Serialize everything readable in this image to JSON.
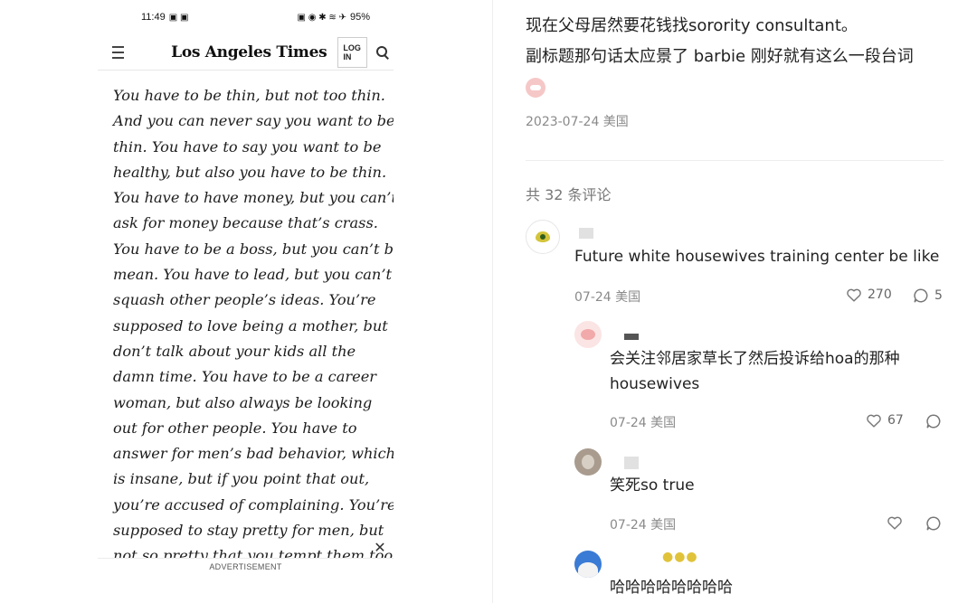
{
  "phone": {
    "status": {
      "time": "11:49",
      "battery": "95%",
      "left_glyphs": "▣ ▣",
      "right_glyphs": "▣ ◉ ✱ ≋ ✈"
    },
    "header": {
      "logo": "Los Angeles Times",
      "login": "LOG IN"
    },
    "article_lines": [
      "You have to be thin, but not too thin.",
      "And you can never say you want to be",
      "thin. You have to say you want to be",
      "healthy, but also you have to be thin.",
      "You have to have money, but you can’t",
      "ask for money because that’s crass.",
      "You have to be a boss, but you can’t be",
      "mean. You have to lead, but you can’t",
      "squash other people’s ideas. You’re",
      "supposed to love being a mother, but",
      "don’t talk about your kids all the",
      "damn time. You have to be a career",
      "woman, but also always be looking",
      "out for other people. You have to",
      "answer for men’s bad behavior, which",
      "is insane, but if you point that out,",
      "you’re accused of complaining. You’re",
      "supposed to stay pretty for men, but",
      "not so pretty that you tempt them too"
    ],
    "ad_close": "✕",
    "ad_label": "ADVERTISEMENT"
  },
  "post": {
    "line1": "现在父母居然要花钱找sorority consultant。",
    "line2": "副标题那句话太应景了 barbie 刚好就有这么一段台词",
    "date": "2023-07-24 美国"
  },
  "comments_count": "共 32 条评论",
  "comments": [
    {
      "text": "Future white housewives training center be like",
      "meta": "07-24 美国",
      "likes": "270",
      "replies": "5"
    },
    {
      "text_line1": "会关注邻居家草长了然后投诉给hoa的那种",
      "text_line2": "housewives",
      "meta": "07-24 美国",
      "likes": "67"
    },
    {
      "text": "笑死so true",
      "meta": "07-24 美国"
    },
    {
      "text": "哈哈哈哈哈哈哈哈"
    }
  ],
  "colors": {
    "meta_gray": "#8a8a8a",
    "text": "#222222",
    "divider": "#eeeeee"
  }
}
